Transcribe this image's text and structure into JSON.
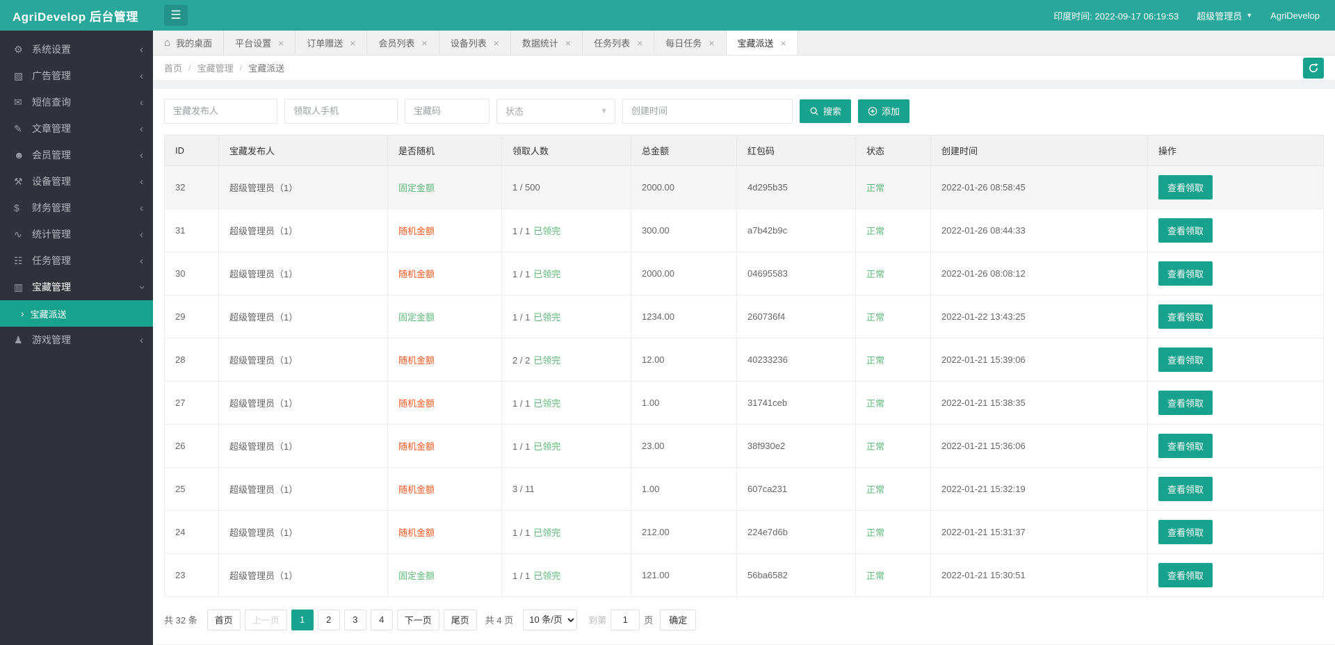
{
  "header": {
    "title": "AgriDevelop 后台管理",
    "time": "印度时间: 2022-09-17 06:19:53",
    "user": "超级管理员",
    "brand": "AgriDevelop"
  },
  "colors": {
    "header_bg": "#2aa79b",
    "primary": "#17a28e",
    "sidebar_bg": "#2f323a",
    "green": "#5FB878",
    "red": "#FF5722"
  },
  "sidebar": {
    "items": [
      {
        "key": "system-settings",
        "label": "系统设置",
        "icon": "gear"
      },
      {
        "key": "ad-management",
        "label": "广告管理",
        "icon": "image"
      },
      {
        "key": "sms-query",
        "label": "短信查询",
        "icon": "mail"
      },
      {
        "key": "article-management",
        "label": "文章管理",
        "icon": "article"
      },
      {
        "key": "member-management",
        "label": "会员管理",
        "icon": "users"
      },
      {
        "key": "device-management",
        "label": "设备管理",
        "icon": "device"
      },
      {
        "key": "finance-management",
        "label": "财务管理",
        "icon": "finance"
      },
      {
        "key": "stats-management",
        "label": "统计管理",
        "icon": "stats"
      },
      {
        "key": "task-management",
        "label": "任务管理",
        "icon": "tasks"
      },
      {
        "key": "treasure-management",
        "label": "宝藏管理",
        "icon": "treasure",
        "expanded": true,
        "children": [
          {
            "key": "treasure-delivery",
            "label": "宝藏派送",
            "active": true
          }
        ]
      },
      {
        "key": "game-management",
        "label": "游戏管理",
        "icon": "game"
      }
    ]
  },
  "tabs": [
    {
      "key": "desktop",
      "label": "我的桌面",
      "home": true
    },
    {
      "key": "platform-settings",
      "label": "平台设置",
      "closable": true
    },
    {
      "key": "order-gift",
      "label": "订单赠送",
      "closable": true
    },
    {
      "key": "member-list",
      "label": "会员列表",
      "closable": true
    },
    {
      "key": "device-list",
      "label": "设备列表",
      "closable": true
    },
    {
      "key": "data-stats",
      "label": "数据统计",
      "closable": true
    },
    {
      "key": "task-list",
      "label": "任务列表",
      "closable": true
    },
    {
      "key": "daily-task",
      "label": "每日任务",
      "closable": true
    },
    {
      "key": "treasure-delivery",
      "label": "宝藏派送",
      "closable": true,
      "active": true
    }
  ],
  "breadcrumb": [
    "首页",
    "宝藏管理",
    "宝藏派送"
  ],
  "filters": {
    "publisher_placeholder": "宝藏发布人",
    "phone_placeholder": "领取人手机",
    "code_placeholder": "宝藏码",
    "status_placeholder": "状态",
    "time_placeholder": "创建时间",
    "search_label": "搜索",
    "add_label": "添加"
  },
  "table": {
    "columns": [
      "ID",
      "宝藏发布人",
      "是否随机",
      "领取人数",
      "总金额",
      "红包码",
      "状态",
      "创建时间",
      "操作"
    ],
    "action_label": "查看领取",
    "rows": [
      {
        "id": "32",
        "publisher": "超级管理员（1）",
        "random_type": "固定金额",
        "random_kind": "fixed",
        "claim": "1 / 500",
        "claim_done": "",
        "amount": "2000.00",
        "code": "4d295b35",
        "status": "正常",
        "created": "2022-01-26 08:58:45"
      },
      {
        "id": "31",
        "publisher": "超级管理员（1）",
        "random_type": "随机金额",
        "random_kind": "random",
        "claim": "1 / 1",
        "claim_done": "已领完",
        "amount": "300.00",
        "code": "a7b42b9c",
        "status": "正常",
        "created": "2022-01-26 08:44:33"
      },
      {
        "id": "30",
        "publisher": "超级管理员（1）",
        "random_type": "随机金额",
        "random_kind": "random",
        "claim": "1 / 1",
        "claim_done": "已领完",
        "amount": "2000.00",
        "code": "04695583",
        "status": "正常",
        "created": "2022-01-26 08:08:12"
      },
      {
        "id": "29",
        "publisher": "超级管理员（1）",
        "random_type": "固定金额",
        "random_kind": "fixed",
        "claim": "1 / 1",
        "claim_done": "已领完",
        "amount": "1234.00",
        "code": "260736f4",
        "status": "正常",
        "created": "2022-01-22 13:43:25"
      },
      {
        "id": "28",
        "publisher": "超级管理员（1）",
        "random_type": "随机金额",
        "random_kind": "random",
        "claim": "2 / 2",
        "claim_done": "已领完",
        "amount": "12.00",
        "code": "40233236",
        "status": "正常",
        "created": "2022-01-21 15:39:06"
      },
      {
        "id": "27",
        "publisher": "超级管理员（1）",
        "random_type": "随机金额",
        "random_kind": "random",
        "claim": "1 / 1",
        "claim_done": "已领完",
        "amount": "1.00",
        "code": "31741ceb",
        "status": "正常",
        "created": "2022-01-21 15:38:35"
      },
      {
        "id": "26",
        "publisher": "超级管理员（1）",
        "random_type": "随机金额",
        "random_kind": "random",
        "claim": "1 / 1",
        "claim_done": "已领完",
        "amount": "23.00",
        "code": "38f930e2",
        "status": "正常",
        "created": "2022-01-21 15:36:06"
      },
      {
        "id": "25",
        "publisher": "超级管理员（1）",
        "random_type": "随机金额",
        "random_kind": "random",
        "claim": "3 / 11",
        "claim_done": "",
        "amount": "1.00",
        "code": "607ca231",
        "status": "正常",
        "created": "2022-01-21 15:32:19"
      },
      {
        "id": "24",
        "publisher": "超级管理员（1）",
        "random_type": "随机金额",
        "random_kind": "random",
        "claim": "1 / 1",
        "claim_done": "已领完",
        "amount": "212.00",
        "code": "224e7d6b",
        "status": "正常",
        "created": "2022-01-21 15:31:37"
      },
      {
        "id": "23",
        "publisher": "超级管理员（1）",
        "random_type": "固定金额",
        "random_kind": "fixed",
        "claim": "1 / 1",
        "claim_done": "已领完",
        "amount": "121.00",
        "code": "56ba6582",
        "status": "正常",
        "created": "2022-01-21 15:30:51"
      }
    ]
  },
  "pagination": {
    "total_label": "共 32 条",
    "pages": [
      {
        "key": "first",
        "label": "首页"
      },
      {
        "key": "prev",
        "label": "上一页",
        "disabled": true
      },
      {
        "key": "1",
        "label": "1",
        "active": true
      },
      {
        "key": "2",
        "label": "2"
      },
      {
        "key": "3",
        "label": "3"
      },
      {
        "key": "4",
        "label": "4"
      },
      {
        "key": "next",
        "label": "下一页"
      },
      {
        "key": "last",
        "label": "尾页"
      }
    ],
    "pages_label": "共 4 页",
    "page_size": "10 条/页",
    "jump_prefix": "到第",
    "jump_value": "1",
    "jump_suffix": "页",
    "confirm_label": "确定"
  }
}
